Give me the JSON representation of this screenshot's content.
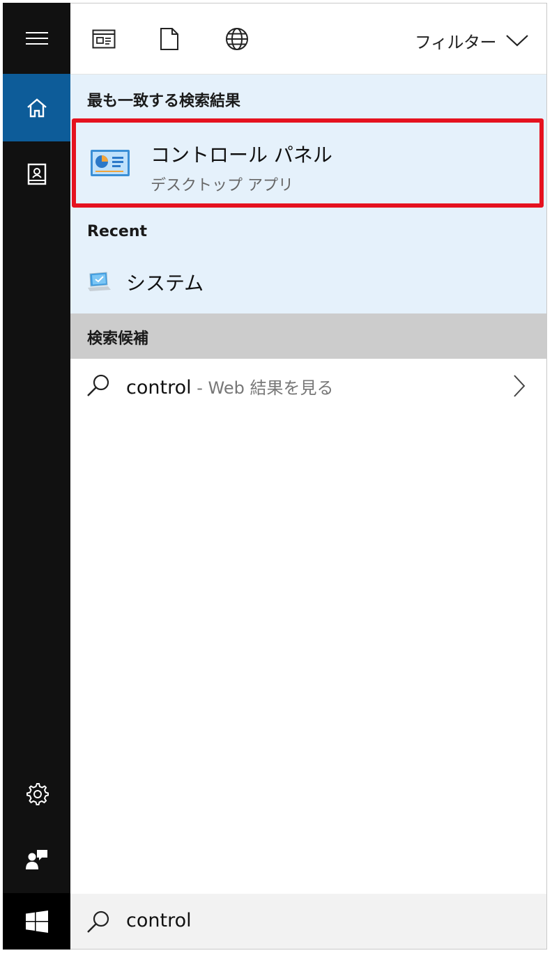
{
  "rail": {
    "items": [
      {
        "name": "menu",
        "icon": "hamburger-menu-icon"
      },
      {
        "name": "home",
        "icon": "home-icon"
      },
      {
        "name": "notebook",
        "icon": "notebook-icon"
      },
      {
        "name": "settings",
        "icon": "gear-icon"
      },
      {
        "name": "feedback",
        "icon": "feedback-icon"
      },
      {
        "name": "start",
        "icon": "windows-logo-icon"
      }
    ],
    "active_color": "#0d5c99"
  },
  "topbar": {
    "scopes": [
      {
        "name": "apps",
        "icon": "app-window-icon"
      },
      {
        "name": "documents",
        "icon": "document-icon"
      },
      {
        "name": "web",
        "icon": "globe-icon"
      }
    ],
    "filter_label": "フィルター"
  },
  "best_match": {
    "heading": "最も一致する検索結果",
    "title": "コントロール パネル",
    "subtitle": "デスクトップ アプリ",
    "icon": "control-panel-icon",
    "highlight_color": "#e5121f"
  },
  "recent": {
    "heading": "Recent",
    "items": [
      {
        "label": "システム",
        "icon": "system-computer-icon"
      }
    ]
  },
  "suggestions": {
    "heading": "検索候補",
    "items": [
      {
        "query": "control",
        "hint": " - Web 結果を見る"
      }
    ]
  },
  "search": {
    "value": "control"
  }
}
